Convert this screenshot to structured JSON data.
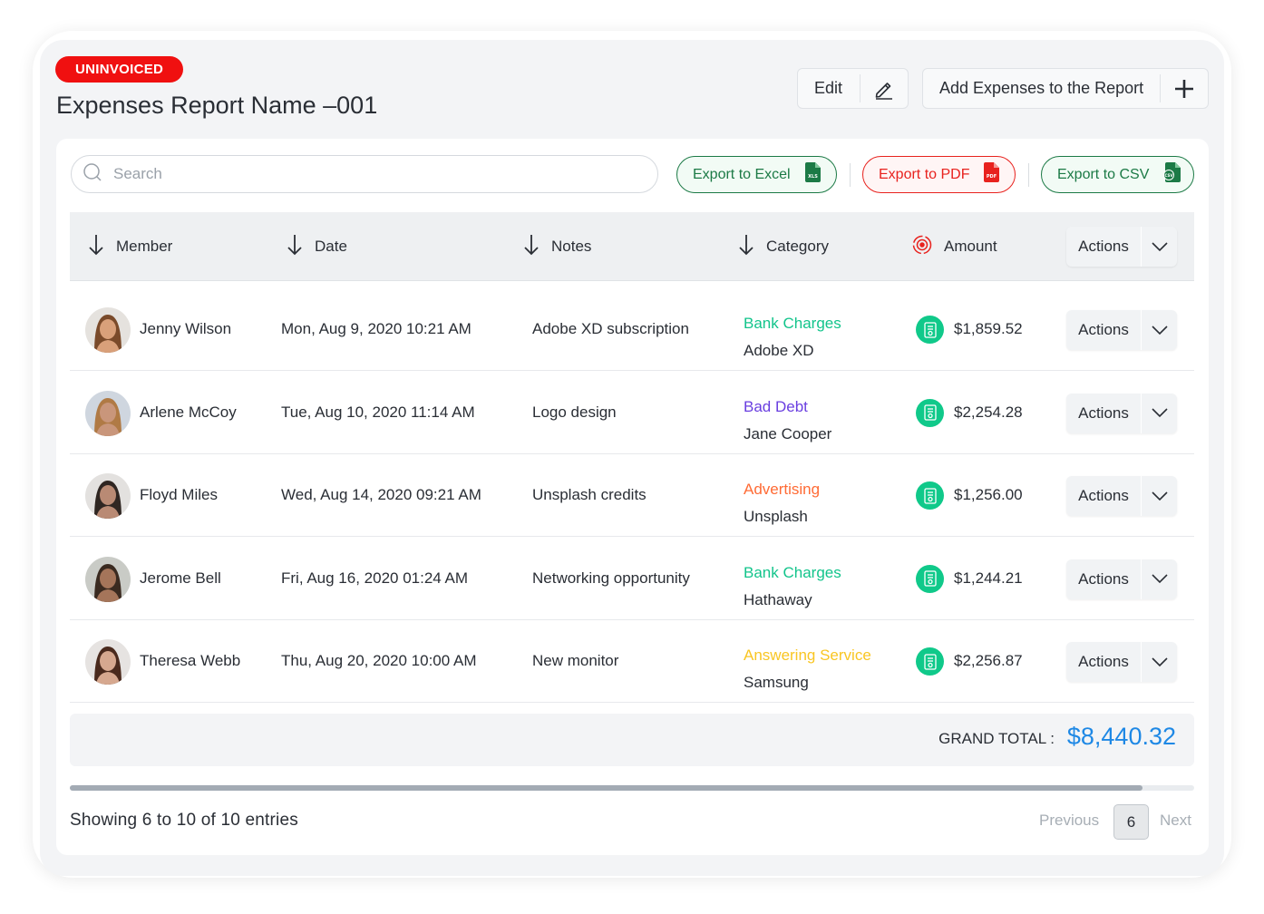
{
  "header": {
    "status_badge": "UNINVOICED",
    "title": "Expenses Report Name –001",
    "edit_label": "Edit",
    "add_expenses_label": "Add Expenses to the Report"
  },
  "toolbar": {
    "search_placeholder": "Search",
    "export_excel": "Export to Excel",
    "export_pdf": "Export to PDF",
    "export_csv": "Export to CSV"
  },
  "table": {
    "columns": {
      "member": "Member",
      "date": "Date",
      "notes": "Notes",
      "category": "Category",
      "amount": "Amount",
      "actions": "Actions"
    },
    "rows": [
      {
        "member": "Jenny Wilson",
        "date": "Mon, Aug 9, 2020 10:21 AM",
        "notes": "Adobe XD subscription",
        "category": "Bank Charges",
        "category_color": "#12c48b",
        "vendor": "Adobe XD",
        "amount": "$1,859.52",
        "actions": "Actions"
      },
      {
        "member": "Arlene McCoy",
        "date": "Tue, Aug 10, 2020 11:14 AM",
        "notes": "Logo design",
        "category": "Bad Debt",
        "category_color": "#6a3fe0",
        "vendor": "Jane Cooper",
        "amount": "$2,254.28",
        "actions": "Actions"
      },
      {
        "member": "Floyd Miles",
        "date": "Wed, Aug 14, 2020 09:21 AM",
        "notes": "Unsplash credits",
        "category": "Advertising",
        "category_color": "#ff6b35",
        "vendor": "Unsplash",
        "amount": "$1,256.00",
        "actions": "Actions"
      },
      {
        "member": "Jerome Bell",
        "date": "Fri, Aug 16, 2020 01:24 AM",
        "notes": "Networking opportunity",
        "category": "Bank Charges",
        "category_color": "#12c48b",
        "vendor": "Hathaway",
        "amount": "$1,244.21",
        "actions": "Actions"
      },
      {
        "member": "Theresa Webb",
        "date": "Thu, Aug 20, 2020 10:00 AM",
        "notes": "New monitor",
        "category": "Answering Service",
        "category_color": "#f9c623",
        "vendor": "Samsung",
        "amount": "$2,256.87",
        "actions": "Actions"
      }
    ]
  },
  "totals": {
    "label": "GRAND TOTAL :",
    "value": "$8,440.32"
  },
  "pagination": {
    "entries_text": "Showing 6 to 10 of 10 entries",
    "previous": "Previous",
    "current_page": "6",
    "next": "Next"
  },
  "icons": {
    "sort": "arrow-down-icon",
    "amount_header": "target-coin-icon",
    "amount_row": "receipt-icon",
    "edit": "pencil-icon",
    "add": "plus-icon",
    "excel": "xls-file-icon",
    "pdf": "pdf-file-icon",
    "csv": "csv-file-icon",
    "dropdown": "chevron-down-icon",
    "search": "search-icon"
  },
  "colors": {
    "badge": "#f01010",
    "excel": "#1c7a46",
    "pdf": "#e8221e",
    "total": "#1e88e5",
    "amount_icon": "#10c98a"
  }
}
